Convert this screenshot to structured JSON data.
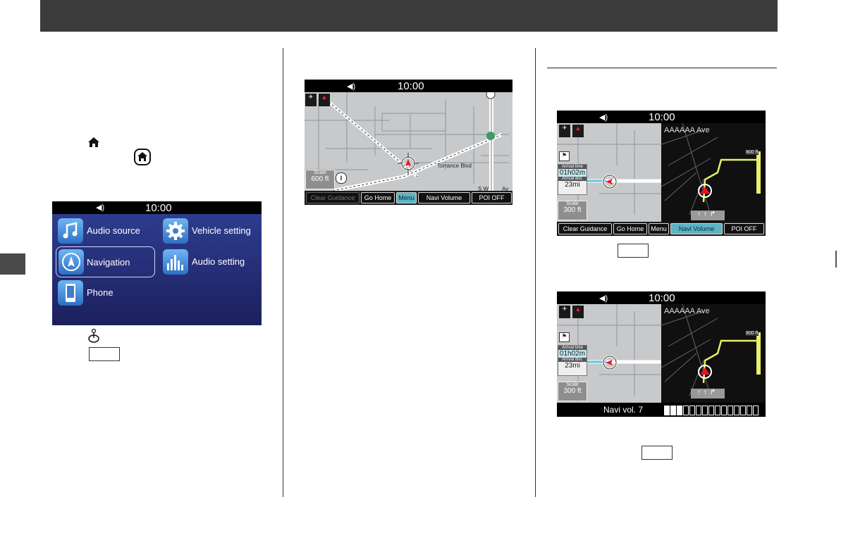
{
  "colors": {
    "header": "#3c3c3c",
    "menu_gradient_top": "#2d3c8e",
    "active_button": "#5bb3c6",
    "route": "#e9ee6a"
  },
  "icons": [
    "home-icon",
    "home-button-icon",
    "speaker-icon",
    "music-note-icon",
    "gear-icon",
    "navigation-arrow-icon",
    "equalizer-icon",
    "phone-icon",
    "joystick-icon",
    "gps-icon",
    "compass-icon",
    "restaurant-icon",
    "crosshair-icon"
  ],
  "home_screen": {
    "time": "10:00",
    "tiles": {
      "audio_source": "Audio source",
      "vehicle_setting": "Vehicle setting",
      "navigation": "Navigation",
      "audio_setting": "Audio setting",
      "phone": "Phone"
    }
  },
  "map_screen": {
    "time": "10:00",
    "street": "Torrance Blvd",
    "street_partial": "S W",
    "street_partial2": "Av",
    "scale_label": "Scale",
    "scale_value": "600 ft",
    "buttons": [
      "Clear Guidance",
      "Go Home",
      "Menu",
      "Navi Volume",
      "POI OFF"
    ]
  },
  "guidance_screen_1": {
    "time": "10:00",
    "street": "AAAAAA Ave",
    "distance": "800 ft",
    "arrival_time_label": "Arrival time",
    "arrival_time": "01h02m",
    "arrival_dist_label": "Arrival dist.",
    "arrival_dist": "23mi",
    "scale_label": "Scale",
    "scale_value": "300 ft",
    "buttons": [
      "Clear Guidance",
      "Go Home",
      "Menu",
      "Navi Volume",
      "POI OFF"
    ]
  },
  "guidance_screen_2": {
    "time": "10:00",
    "street": "AAAAAA Ave",
    "distance": "800 ft",
    "arrival_time_label": "Arrival time",
    "arrival_time": "01h02m",
    "arrival_dist_label": "Arrival dist.",
    "arrival_dist": "23mi",
    "scale_label": "Scale",
    "scale_value": "300 ft",
    "volume_label": "Navi vol.  7",
    "volume_level": 3,
    "volume_max": 15
  }
}
